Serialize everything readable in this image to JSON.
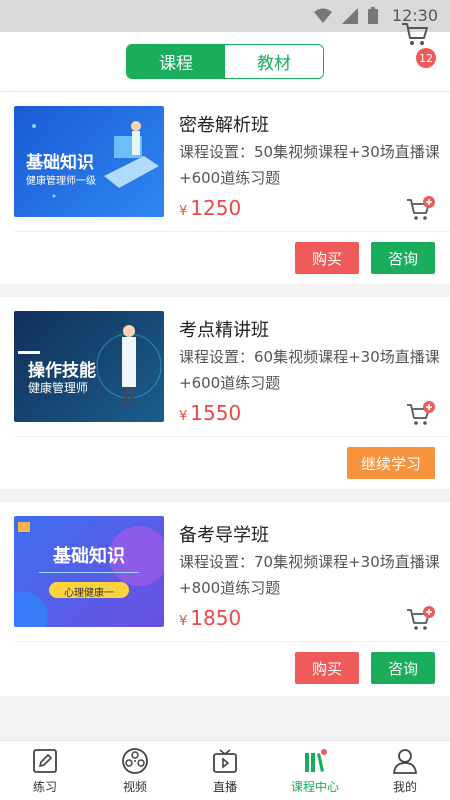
{
  "status_bar": {
    "time": "12:30"
  },
  "header": {
    "segments": [
      {
        "label": "课程",
        "active": true
      },
      {
        "label": "教材",
        "active": false
      }
    ],
    "cart_badge": "12"
  },
  "courses": [
    {
      "title": "密卷解析班",
      "desc": "课程设置：50集视频课程+30场直播课+600道练习题",
      "currency": "¥",
      "price": "1250",
      "thumb": {
        "headline": "基础知识",
        "sub": "健康管理师一级"
      },
      "buttons": [
        "购买",
        "咨询"
      ]
    },
    {
      "title": "考点精讲班",
      "desc": "课程设置：60集视频课程+30场直播课+600道练习题",
      "currency": "¥",
      "price": "1550",
      "thumb": {
        "headline": "操作技能",
        "sub": "健康管理师"
      },
      "buttons": [
        "继续学习"
      ]
    },
    {
      "title": "备考导学班",
      "desc": "课程设置：70集视频课程+30场直播课+800道练习题",
      "currency": "¥",
      "price": "1850",
      "thumb": {
        "headline": "基础知识",
        "sub": "心理健康一"
      },
      "buttons": [
        "购买",
        "咨询"
      ]
    }
  ],
  "tabbar": [
    {
      "label": "练习",
      "icon": "pencil-icon",
      "active": false
    },
    {
      "label": "视频",
      "icon": "film-reel-icon",
      "active": false
    },
    {
      "label": "直播",
      "icon": "tv-play-icon",
      "active": false
    },
    {
      "label": "课程中心",
      "icon": "books-icon",
      "active": true
    },
    {
      "label": "我的",
      "icon": "user-icon",
      "active": false
    }
  ],
  "colors": {
    "primary": "#1aad5c",
    "price": "#e84a4a",
    "buy": "#ef5a5a",
    "continue": "#f7923d"
  }
}
